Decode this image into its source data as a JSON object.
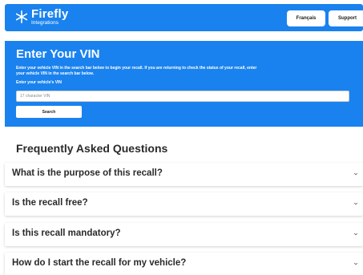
{
  "header": {
    "logo_name": "Firefly",
    "logo_subtitle": "Integrations",
    "lang_button": "Français",
    "support_button": "Support",
    "logo_icon": "snowflake-firefly-icon"
  },
  "vin": {
    "title": "Enter Your VIN",
    "description": "Enter your vehicle VIN in the search bar below to begin your recall. If you are returning to check the status of your recall, enter your vehicle VIN in the search bar below.",
    "label": "Enter your vehicle's VIN",
    "placeholder": "17 character VIN",
    "value": "",
    "search_button": "Search"
  },
  "faq": {
    "heading": "Frequently Asked Questions",
    "items": [
      {
        "question": "What is the purpose of this recall?"
      },
      {
        "question": "Is the recall free?"
      },
      {
        "question": "Is this recall mandatory?"
      },
      {
        "question": "How do I start the recall for my vehicle?"
      }
    ],
    "chevron_icon": "chevron-down-icon"
  },
  "colors": {
    "brand_blue": "#1a82ee",
    "text_dark": "#2a2a2a",
    "white": "#ffffff"
  }
}
